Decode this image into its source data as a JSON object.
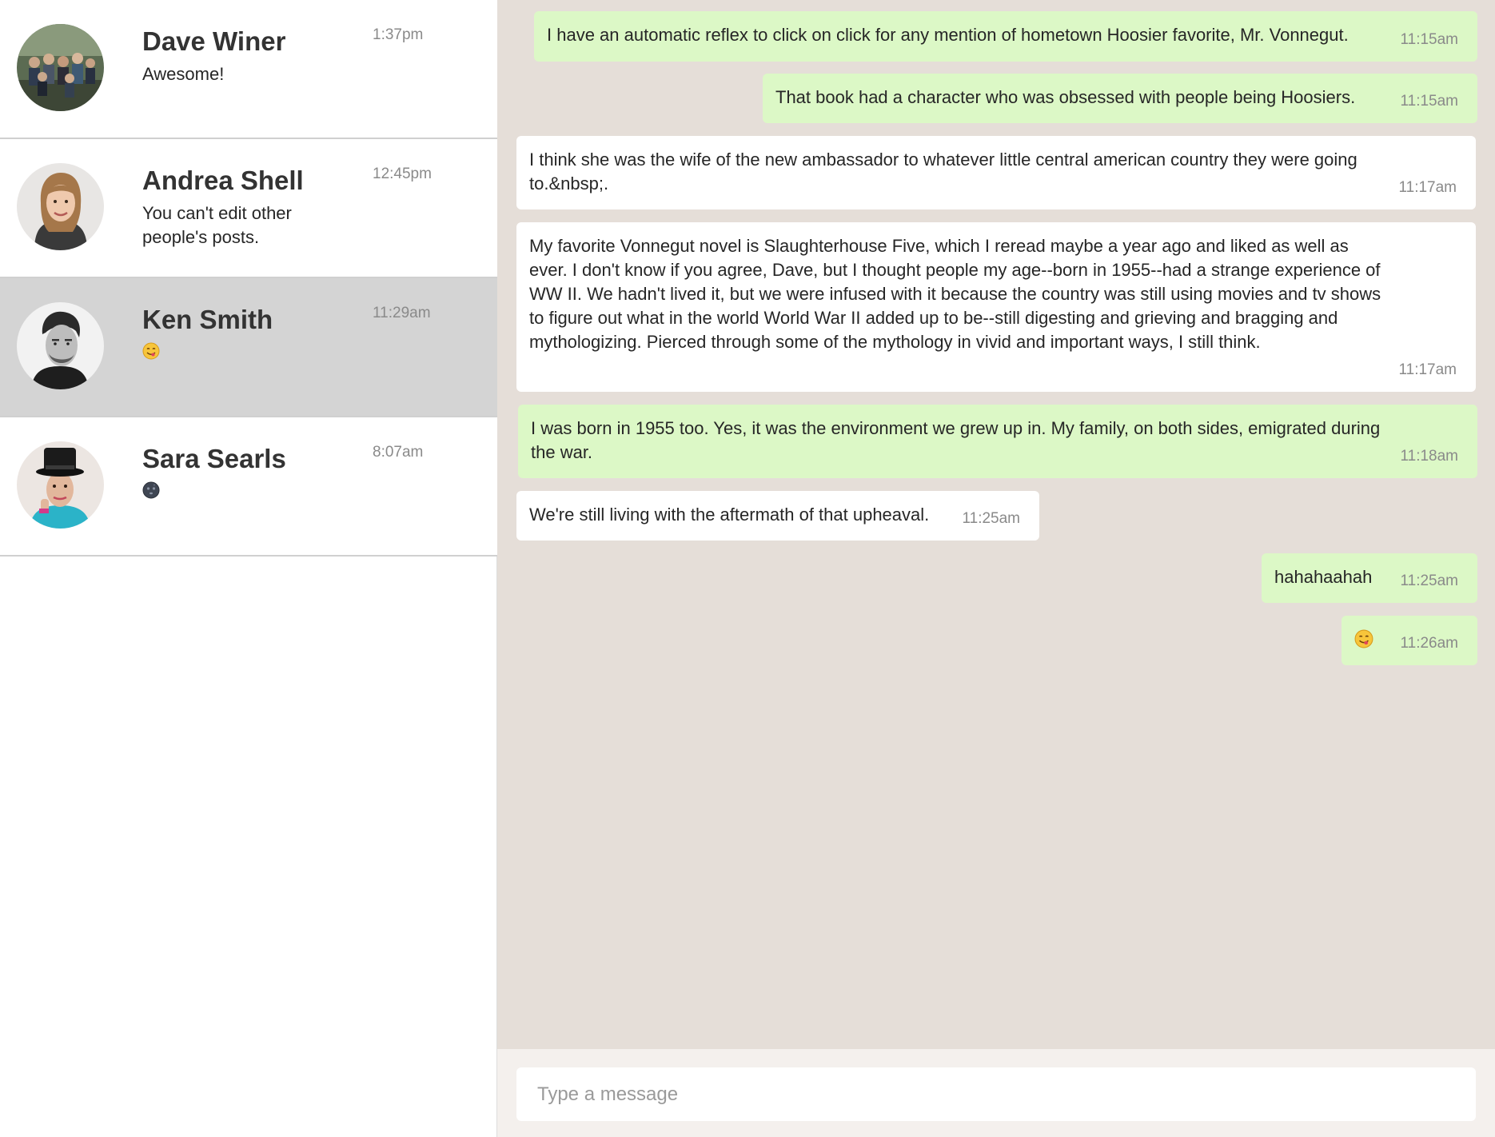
{
  "sidebar": {
    "contacts": [
      {
        "name": "Dave Winer",
        "preview": "Awesome!",
        "time": "1:37pm",
        "avatar_icon": "avatar-photo-group-outdoors",
        "active": false
      },
      {
        "name": "Andrea Shell",
        "preview": "You can't edit other people's posts.",
        "time": "12:45pm",
        "avatar_icon": "avatar-photo-woman",
        "active": false
      },
      {
        "name": "Ken Smith",
        "preview_emoji": "smiling-face-tongue-icon",
        "time": "11:29am",
        "avatar_icon": "avatar-photo-man-bw",
        "active": true
      },
      {
        "name": "Sara Searls",
        "preview_emoji": "dark-moon-face-icon",
        "time": "8:07am",
        "avatar_icon": "avatar-photo-man-hat",
        "active": false
      }
    ]
  },
  "chat": {
    "messages": [
      {
        "direction": "out",
        "text": "I have an automatic reflex to click on click for any mention of hometown Hoosier favorite, Mr. Vonnegut.",
        "time": "11:15am"
      },
      {
        "direction": "out",
        "text": "That book had a character who was obsessed with people being Hoosiers.",
        "time": "11:15am"
      },
      {
        "direction": "in",
        "text": "I think she was the wife of the new ambassador to whatever little central american country they were going to.&nbsp;.",
        "time": "11:17am"
      },
      {
        "direction": "in",
        "text": "My favorite Vonnegut novel is Slaughterhouse Five, which I reread maybe a year ago and liked as well as ever. I don't know if you agree, Dave, but I thought people my age--born in 1955--had a strange experience of WW II. We hadn't lived it, but we were infused with it because the country was still using movies and tv shows to figure out what in the world World War II added up to be--still digesting and grieving and bragging and mythologizing. Pierced through some of the mythology in vivid and important ways, I still think.",
        "time": "11:17am"
      },
      {
        "direction": "out",
        "text": "I was born in 1955 too. Yes, it was the environment we grew up in. My family, on both sides, emigrated during the war.",
        "time": "11:18am"
      },
      {
        "direction": "in",
        "text": "We're still living with the aftermath of that upheaval.",
        "time": "11:25am"
      },
      {
        "direction": "out",
        "text": "hahahaahah",
        "time": "11:25am"
      },
      {
        "direction": "out",
        "emoji": "smiling-face-tongue-icon",
        "time": "11:26am"
      }
    ]
  },
  "composer": {
    "placeholder": "Type a message",
    "value": ""
  },
  "colors": {
    "chat_background": "#e5ded8",
    "outgoing_bubble": "#dcf8c6",
    "incoming_bubble": "#ffffff",
    "active_contact": "#d4d4d4",
    "composer_background": "#f4f0ed",
    "timestamp": "#8a8a8a"
  }
}
